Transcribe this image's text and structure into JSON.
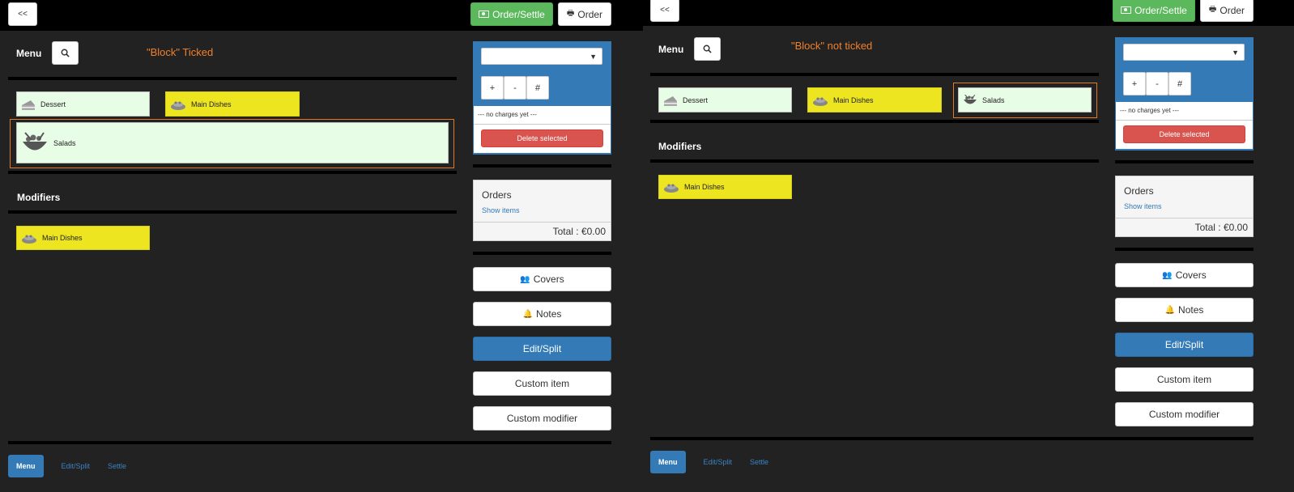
{
  "common": {
    "back_label": "<<",
    "order_settle_label": "Order/Settle",
    "order_label": "Order",
    "menu_label": "Menu",
    "modifiers_label": "Modifiers",
    "no_charges": "--- no charges yet ---",
    "delete_selected": "Delete selected",
    "plus": "+",
    "minus": "-",
    "hash": "#",
    "orders_title": "Orders",
    "show_items": "Show items",
    "total": "Total : €0.00",
    "covers": "Covers",
    "notes": "Notes",
    "edit_split": "Edit/Split",
    "custom_item": "Custom item",
    "custom_modifier": "Custom modifier",
    "tabs": [
      "Menu",
      "Edit/Split",
      "Settle"
    ]
  },
  "left": {
    "annotation": "\"Block\" Ticked",
    "categories": [
      "Dessert",
      "Main Dishes"
    ],
    "selected_block": "Salads",
    "modifiers": [
      "Main Dishes"
    ]
  },
  "right": {
    "annotation": "\"Block\" not ticked",
    "categories": [
      "Dessert",
      "Main Dishes",
      "Salads"
    ],
    "modifiers": [
      "Main Dishes"
    ]
  },
  "colors": {
    "background": "#222222",
    "green_tile": "#e8fde6",
    "yellow_tile": "#ece51f",
    "selection": "#e07a25",
    "primary": "#337ab7",
    "success": "#5cb85c",
    "danger": "#d9534f"
  }
}
